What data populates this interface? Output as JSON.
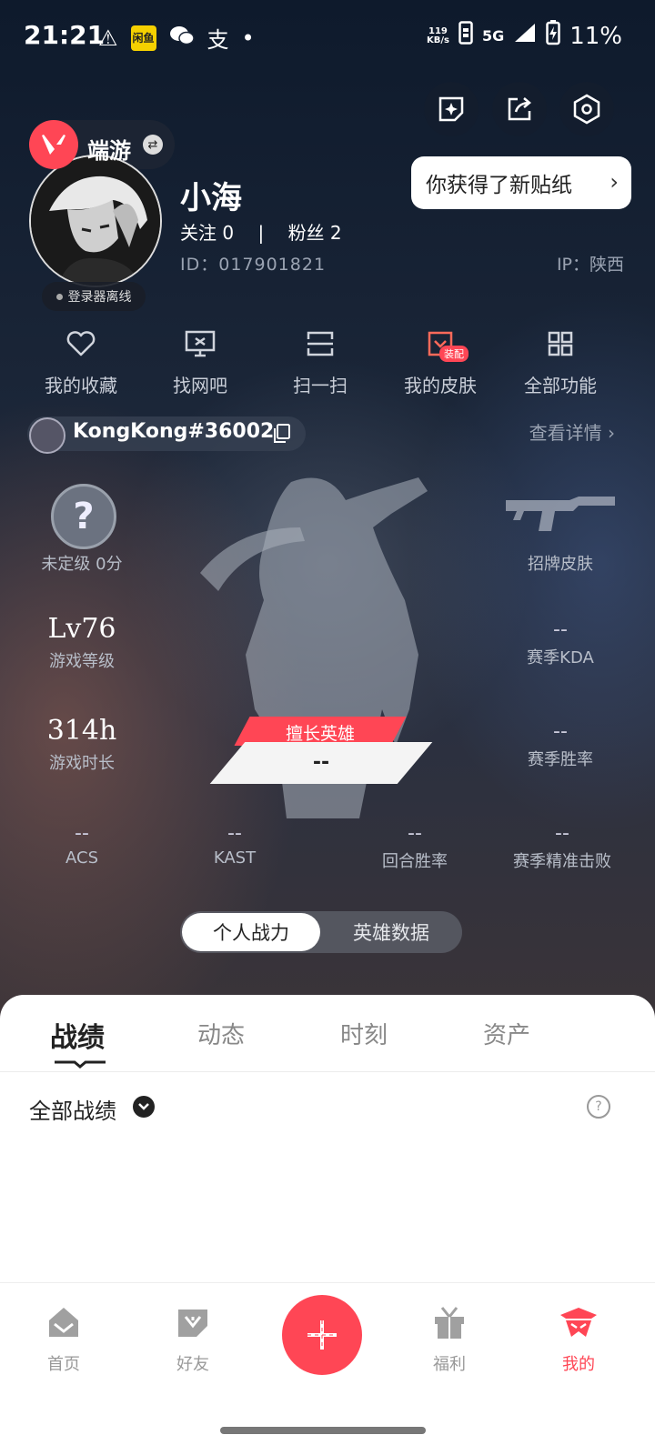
{
  "status_bar": {
    "time": "21:21",
    "net_speed_top": "119",
    "net_speed_bottom": "KB/s",
    "network": "5G",
    "battery": "11%",
    "shop_icon_text": "闲鱼"
  },
  "tooltip": {
    "text": "你获得了新贴纸"
  },
  "profile": {
    "game_name": "端游",
    "offline_label": "登录器离线",
    "username": "小海",
    "follow_label": "关注",
    "follow_count": "0",
    "fans_label": "粉丝",
    "fans_count": "2",
    "separator": "|",
    "id_text": "ID：017901821",
    "ip_text": "IP：陕西"
  },
  "quick_menu": [
    {
      "label": "我的收藏",
      "icon": "heart-icon"
    },
    {
      "label": "找网吧",
      "icon": "monitor-icon"
    },
    {
      "label": "扫一扫",
      "icon": "scan-icon"
    },
    {
      "label": "我的皮肤",
      "icon": "skin-icon",
      "badge": "装配"
    },
    {
      "label": "全部功能",
      "icon": "grid-icon"
    }
  ],
  "account": {
    "name": "KongKong#36002",
    "detail_link": "查看详情"
  },
  "stats": {
    "rank": {
      "icon_text": "?",
      "label": "未定级 0分"
    },
    "signature_skin": "招牌皮肤",
    "level": {
      "value": "Lv76",
      "label": "游戏等级"
    },
    "season_kda": {
      "value": "--",
      "label": "赛季KDA"
    },
    "play_time": {
      "value": "314h",
      "label": "游戏时长"
    },
    "season_winrate": {
      "value": "--",
      "label": "赛季胜率"
    },
    "best_hero": {
      "banner": "擅长英雄",
      "value": "--"
    },
    "acs": {
      "value": "--",
      "label": "ACS"
    },
    "kast": {
      "value": "--",
      "label": "KAST"
    },
    "round_winrate": {
      "value": "--",
      "label": "回合胜率"
    },
    "season_headshot": {
      "value": "--",
      "label": "赛季精准击败"
    }
  },
  "toggle": {
    "on": "个人战力",
    "off": "英雄数据"
  },
  "tabs": [
    "战绩",
    "动态",
    "时刻",
    "资产"
  ],
  "filter": {
    "label": "全部战绩"
  },
  "bottom_nav": [
    {
      "label": "首页",
      "icon": "home-icon"
    },
    {
      "label": "好友",
      "icon": "friends-icon"
    },
    {
      "label": "福利",
      "icon": "gift-icon"
    },
    {
      "label": "我的",
      "icon": "me-icon"
    }
  ],
  "colors": {
    "accent": "#ff4655",
    "panel": "#ffffff",
    "bg_dark": "#1b2638"
  }
}
